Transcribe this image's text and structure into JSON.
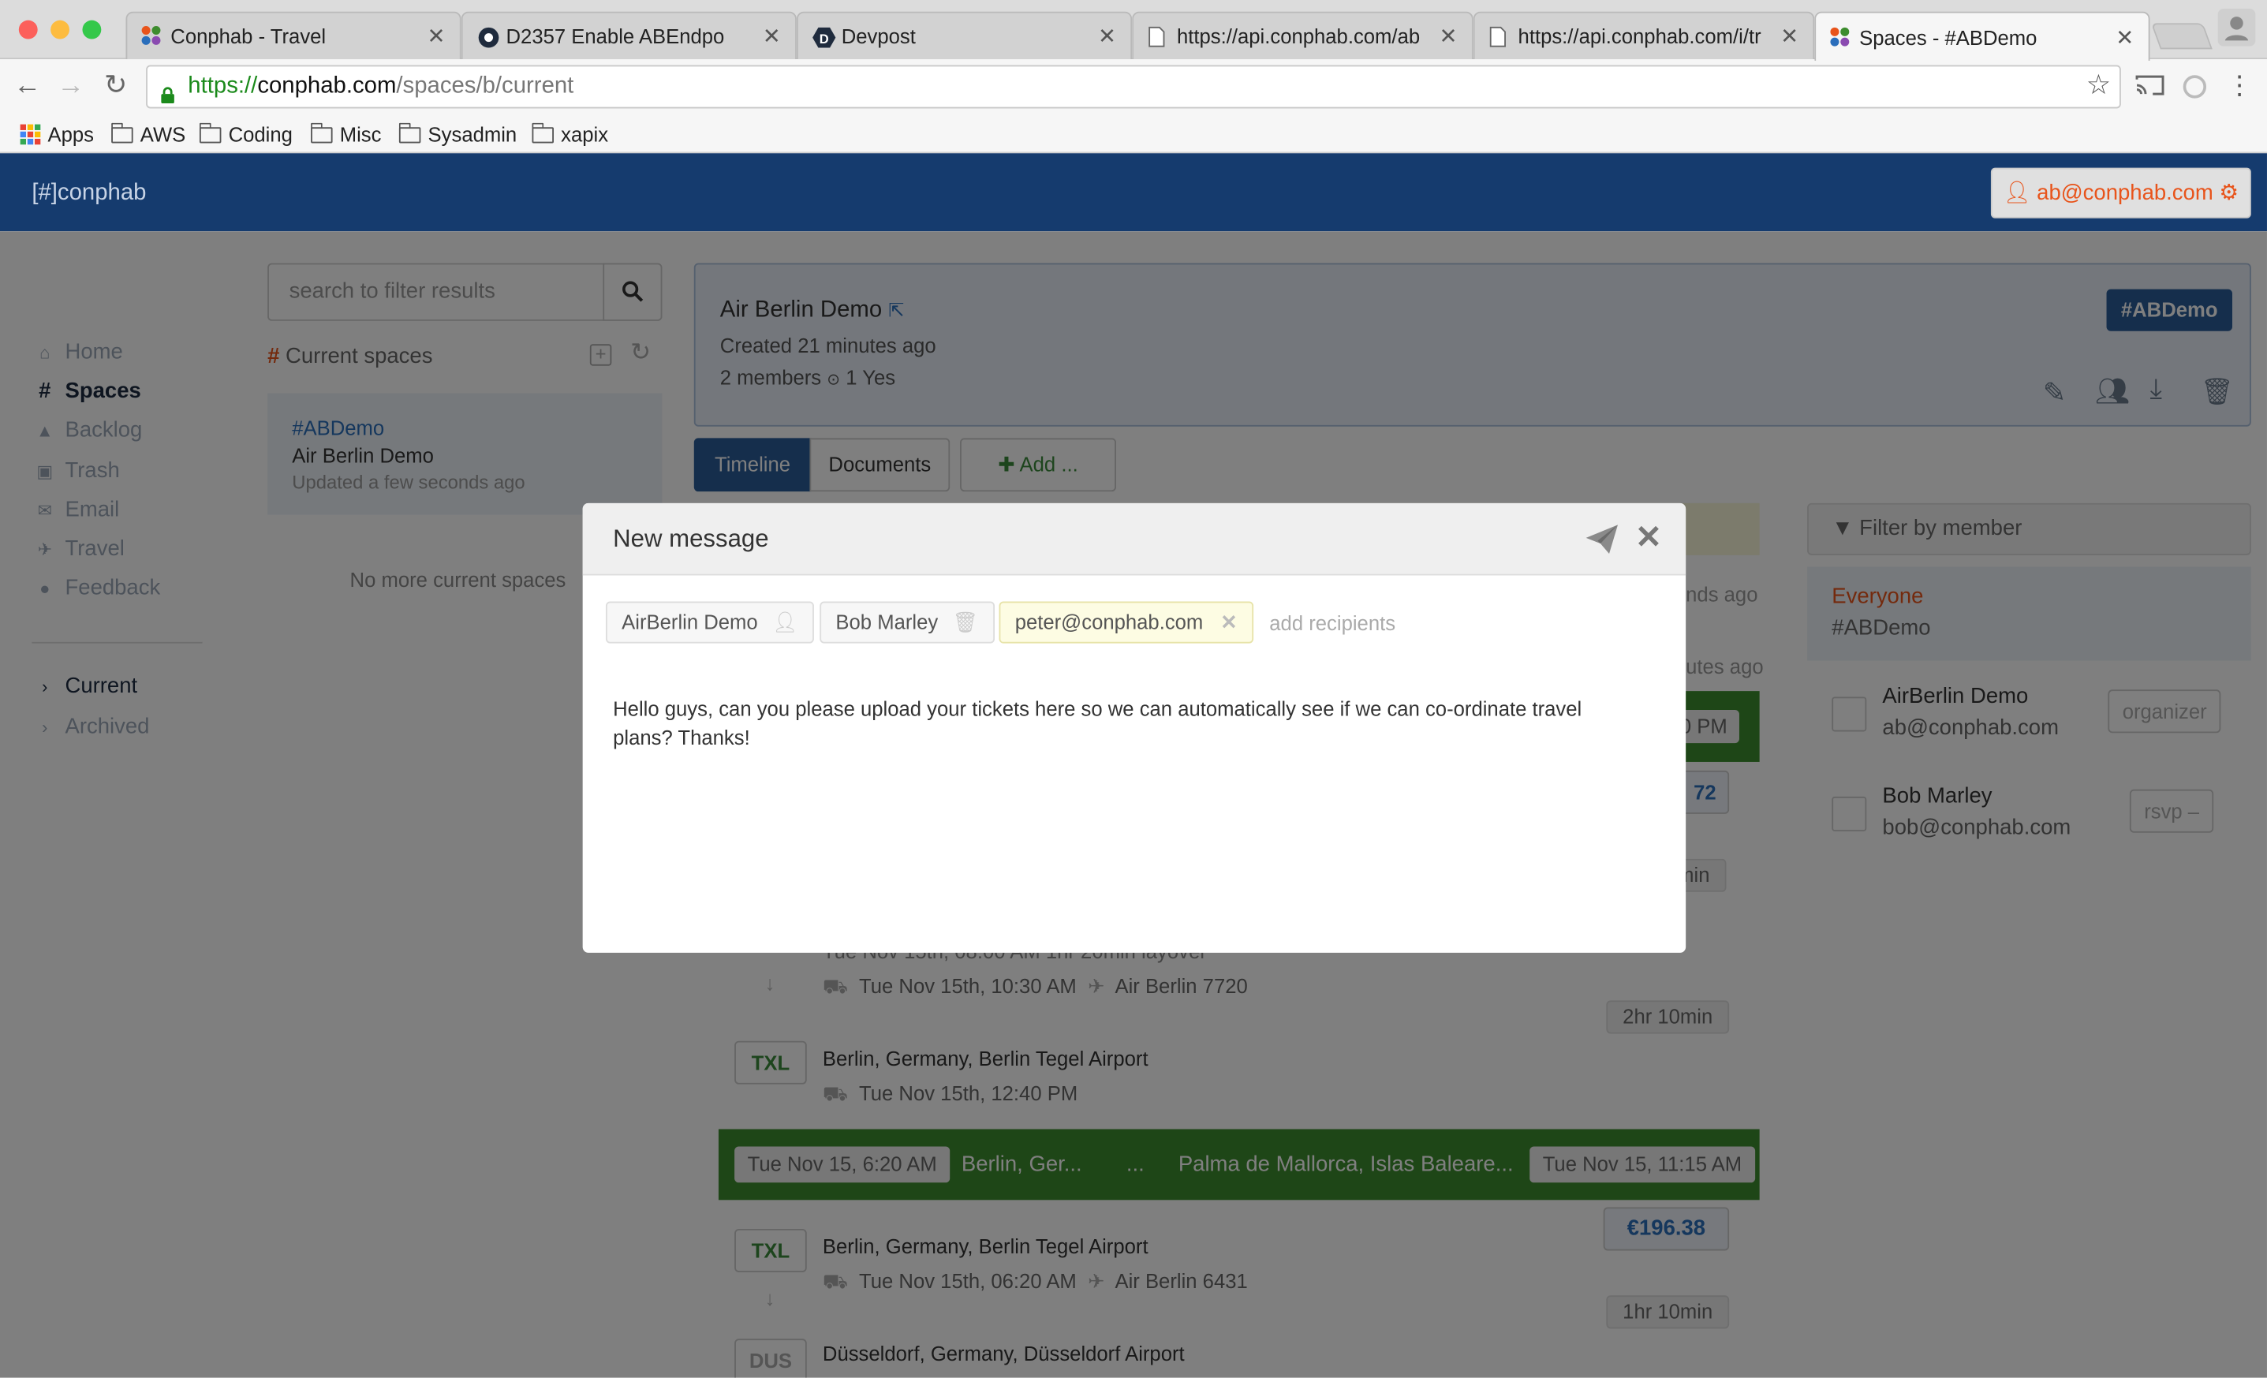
{
  "browser": {
    "tabs": [
      {
        "title": "Conphab - Travel",
        "favicon": "conphab-logo"
      },
      {
        "title": "D2357 Enable ABEndpo",
        "favicon": "phabricator-gear"
      },
      {
        "title": "Devpost",
        "favicon": "devpost-logo"
      },
      {
        "title": "https://api.conphab.com/ab",
        "favicon": "page-icon"
      },
      {
        "title": "https://api.conphab.com/i/tr",
        "favicon": "page-icon"
      },
      {
        "title": "Spaces - #ABDemo",
        "favicon": "conphab-logo"
      }
    ],
    "url_scheme": "https://",
    "url_host": "conphab.com",
    "url_path": "/spaces/b/current",
    "bookmarks": [
      "Apps",
      "AWS",
      "Coding",
      "Misc",
      "Sysadmin",
      "xapix"
    ]
  },
  "app": {
    "brand": "[#]conphab",
    "user": "ab@conphab.com",
    "sidebar": [
      {
        "label": "Home",
        "icon": "home-icon"
      },
      {
        "label": "Spaces",
        "icon": "hash-icon"
      },
      {
        "label": "Backlog",
        "icon": "bell-icon"
      },
      {
        "label": "Trash",
        "icon": "trash-icon"
      },
      {
        "label": "Email",
        "icon": "envelope-icon"
      },
      {
        "label": "Travel",
        "icon": "plane-icon"
      },
      {
        "label": "Feedback",
        "icon": "comment-icon"
      }
    ],
    "filters": [
      "Current",
      "Archived"
    ],
    "search_placeholder": "search to filter results",
    "current_spaces_label": "Current spaces",
    "space_card": {
      "tag": "#ABDemo",
      "name": "Air Berlin Demo",
      "updated": "Updated a few seconds ago"
    },
    "no_more": "No more current spaces",
    "space": {
      "title": "Air Berlin Demo",
      "created": "Created 21 minutes ago",
      "members": "2 members",
      "yes": "1 Yes",
      "tag": "#ABDemo"
    },
    "tabs": {
      "timeline": "Timeline",
      "documents": "Documents",
      "add": "Add ..."
    },
    "timeline": {
      "ago1": "nds ago",
      "ago2": "utes ago",
      "pm_frag": "0 PM",
      "num_frag": "72",
      "min_frag": "min",
      "layover_frag": "Tue Nov 15th, 08:00 AM   1hr 20min layover",
      "leg1_time": "Tue Nov 15th, 10:30 AM",
      "leg1_flight": "Air Berlin 7720",
      "duration1": "2hr 10min",
      "arr1_code": "TXL",
      "arr1_place": "Berlin, Germany, Berlin Tegel Airport",
      "arr1_time": "Tue Nov 15th, 12:40 PM",
      "trip": {
        "depart": "Tue Nov 15, 6:20 AM",
        "from": "Berlin, Ger...",
        "dots": "...",
        "to": "Palma de Mallorca, Islas Baleare...",
        "arrive": "Tue Nov 15, 11:15 AM"
      },
      "price": "€196.38",
      "dep2_code": "TXL",
      "dep2_place": "Berlin, Germany, Berlin Tegel Airport",
      "dep2_time": "Tue Nov 15th, 06:20 AM",
      "dep2_flight": "Air Berlin 6431",
      "duration2": "1hr 10min",
      "arr2_code": "DUS",
      "arr2_place": "Düsseldorf, Germany, Düsseldorf Airport"
    },
    "members_panel": {
      "filter": "Filter by member",
      "everyone": "Everyone",
      "everyone_tag": "#ABDemo",
      "members": [
        {
          "name": "AirBerlin Demo",
          "email": "ab@conphab.com",
          "role": "organizer"
        },
        {
          "name": "Bob Marley",
          "email": "bob@conphab.com",
          "role": "rsvp"
        }
      ]
    }
  },
  "modal": {
    "title": "New message",
    "recipients": [
      "AirBerlin Demo",
      "Bob Marley",
      "peter@conphab.com"
    ],
    "add_placeholder": "add recipients",
    "body": "Hello guys, can you please upload your tickets here so we can automatically see if we can co-ordinate travel plans? Thanks!"
  },
  "colors": {
    "navbar": "#153b6e",
    "accent_orange": "#e8541b",
    "trip_green": "#3d8c2e",
    "link_blue": "#2a6ebb"
  }
}
